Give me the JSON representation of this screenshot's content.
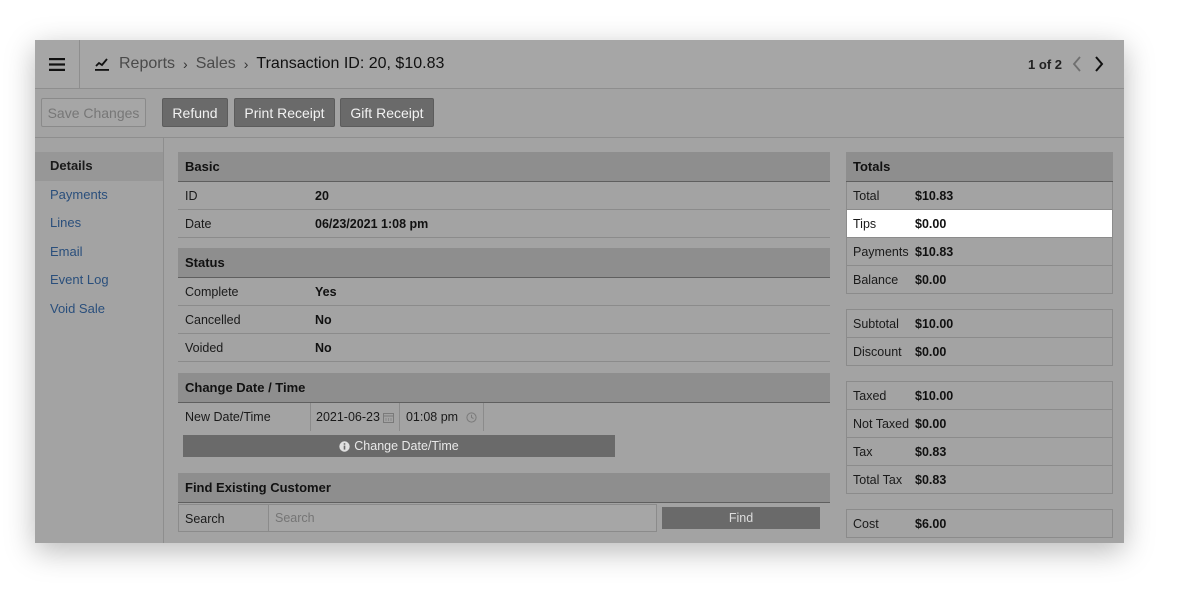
{
  "header": {
    "breadcrumbs": [
      "Reports",
      "Sales"
    ],
    "title": "Transaction ID: 20, $10.83",
    "pager": "1 of 2"
  },
  "toolbar": {
    "save_label": "Save Changes",
    "refund_label": "Refund",
    "print_label": "Print Receipt",
    "gift_label": "Gift Receipt"
  },
  "sidebar": {
    "items": [
      {
        "label": "Details"
      },
      {
        "label": "Payments"
      },
      {
        "label": "Lines"
      },
      {
        "label": "Email"
      },
      {
        "label": "Event Log"
      },
      {
        "label": "Void Sale"
      }
    ]
  },
  "basic": {
    "title": "Basic",
    "rows": [
      {
        "k": "ID",
        "v": "20"
      },
      {
        "k": "Date",
        "v": "06/23/2021 1:08 pm"
      }
    ]
  },
  "status": {
    "title": "Status",
    "rows": [
      {
        "k": "Complete",
        "v": "Yes"
      },
      {
        "k": "Cancelled",
        "v": "No"
      },
      {
        "k": "Voided",
        "v": "No"
      }
    ]
  },
  "change_date": {
    "title": "Change Date / Time",
    "label": "New Date/Time",
    "date_value": "2021-06-23",
    "time_value": "01:08 pm",
    "button_label": "Change Date/Time"
  },
  "find_customer": {
    "title": "Find Existing Customer",
    "label": "Search",
    "placeholder": "Search",
    "button_label": "Find"
  },
  "totals": {
    "title": "Totals",
    "group1": [
      {
        "k": "Total",
        "v": "$10.83"
      },
      {
        "k": "Tips",
        "v": "$0.00"
      },
      {
        "k": "Payments",
        "v": "$10.83"
      },
      {
        "k": "Balance",
        "v": "$0.00"
      }
    ],
    "group2": [
      {
        "k": "Subtotal",
        "v": "$10.00"
      },
      {
        "k": "Discount",
        "v": "$0.00"
      }
    ],
    "group3": [
      {
        "k": "Taxed",
        "v": "$10.00"
      },
      {
        "k": "Not Taxed",
        "v": "$0.00"
      },
      {
        "k": "Tax",
        "v": "$0.83"
      },
      {
        "k": "Total Tax",
        "v": "$0.83"
      }
    ],
    "group4": [
      {
        "k": "Cost",
        "v": "$6.00"
      }
    ]
  },
  "colors": {
    "dim_background": "#a3a3a3",
    "button_dark": "#6a6a6a",
    "link": "#2a4f7c",
    "highlight_row": "#ffffff"
  }
}
